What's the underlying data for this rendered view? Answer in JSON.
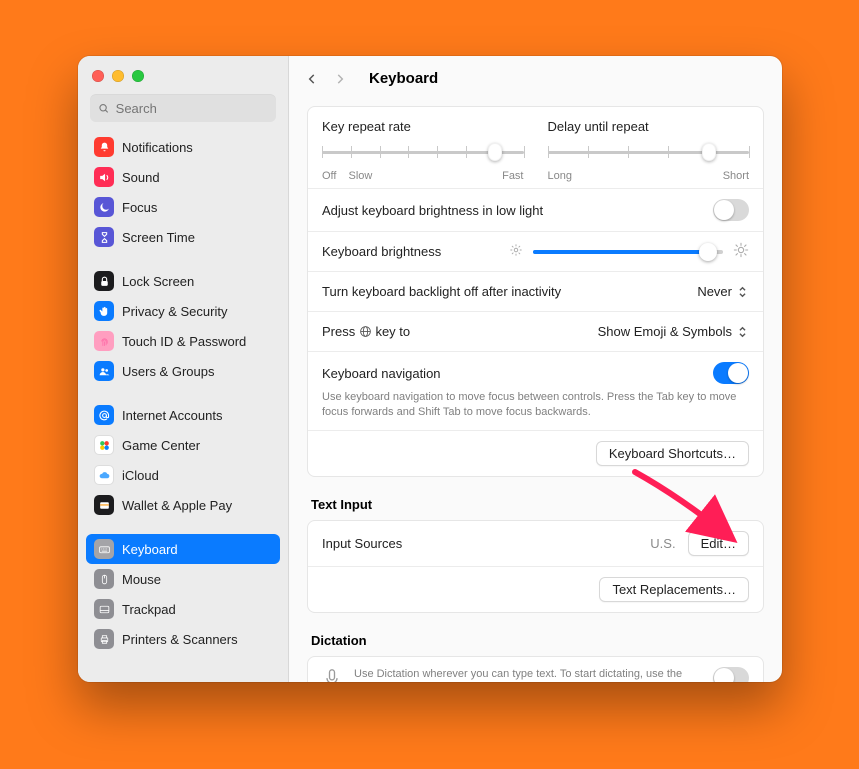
{
  "toolbar": {
    "title": "Keyboard"
  },
  "sidebar": {
    "search_placeholder": "Search",
    "items": [
      {
        "label": "Notifications",
        "icon": "bell",
        "color": "#ff3b30"
      },
      {
        "label": "Sound",
        "icon": "speaker",
        "color": "#ff2d55"
      },
      {
        "label": "Focus",
        "icon": "moon",
        "color": "#5856d6"
      },
      {
        "label": "Screen Time",
        "icon": "hourglass",
        "color": "#5856d6"
      },
      {
        "label": "Lock Screen",
        "icon": "lock",
        "color": "#1c1c1e"
      },
      {
        "label": "Privacy & Security",
        "icon": "hand",
        "color": "#0a7bff"
      },
      {
        "label": "Touch ID & Password",
        "icon": "fingerprint",
        "color": "#ff9ec0"
      },
      {
        "label": "Users & Groups",
        "icon": "users",
        "color": "#0a7bff"
      },
      {
        "label": "Internet Accounts",
        "icon": "at",
        "color": "#0a7bff"
      },
      {
        "label": "Game Center",
        "icon": "game",
        "color": "#ffffff"
      },
      {
        "label": "iCloud",
        "icon": "cloud",
        "color": "#ffffff"
      },
      {
        "label": "Wallet & Apple Pay",
        "icon": "wallet",
        "color": "#1c1c1e"
      },
      {
        "label": "Keyboard",
        "icon": "keyboard",
        "color": "#8e8e93"
      },
      {
        "label": "Mouse",
        "icon": "mouse",
        "color": "#8e8e93"
      },
      {
        "label": "Trackpad",
        "icon": "trackpad",
        "color": "#8e8e93"
      },
      {
        "label": "Printers & Scanners",
        "icon": "printer",
        "color": "#8e8e93"
      }
    ],
    "selected_index": 12,
    "group_breaks": [
      4,
      8,
      12
    ]
  },
  "sliders": {
    "repeat": {
      "title": "Key repeat rate",
      "left": "Off",
      "left2": "Slow",
      "right": "Fast",
      "ticks": 8,
      "value": 6
    },
    "delay": {
      "title": "Delay until repeat",
      "left": "Long",
      "right": "Short",
      "ticks": 6,
      "value": 4
    }
  },
  "rows": {
    "adjust_low_light": {
      "label": "Adjust keyboard brightness in low light",
      "on": false
    },
    "brightness": {
      "label": "Keyboard brightness",
      "value_pct": 92
    },
    "backlight_off": {
      "label": "Turn keyboard backlight off after inactivity",
      "value": "Never"
    },
    "globe": {
      "label_prefix": "Press ",
      "label_suffix": " key to",
      "value": "Show Emoji & Symbols"
    },
    "nav": {
      "label": "Keyboard navigation",
      "desc": "Use keyboard navigation to move focus between controls. Press the Tab key to move focus forwards and Shift Tab to move focus backwards.",
      "on": true
    },
    "shortcuts_btn": "Keyboard Shortcuts…"
  },
  "text_input": {
    "header": "Text Input",
    "input_sources_label": "Input Sources",
    "input_sources_value": "U.S.",
    "edit_btn": "Edit…",
    "replacements_btn": "Text Replacements…"
  },
  "dictation": {
    "header": "Dictation",
    "desc": "Use Dictation wherever you can type text. To start dictating, use the shortcut or select Start Dictation from the Edit menu.",
    "on": false
  },
  "colors": {
    "accent": "#0a7bff",
    "arrow": "#ff1e56"
  }
}
